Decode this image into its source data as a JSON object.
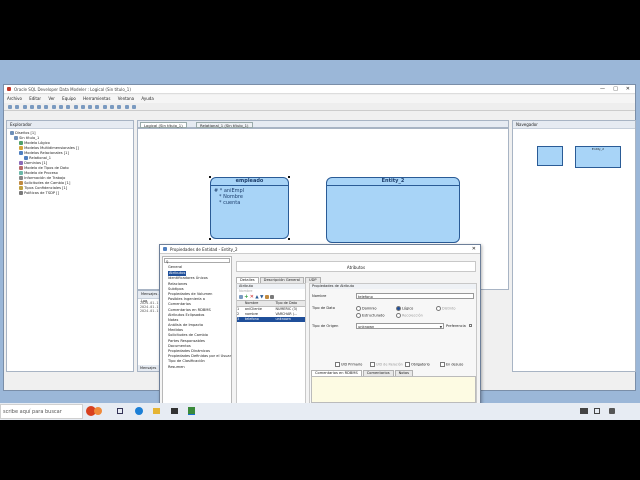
{
  "app": {
    "title": "Oracle SQL Developer Data Modeler : Logical (Sin título_1)",
    "menus": [
      "Archivo",
      "Editar",
      "Ver",
      "Equipo",
      "Herramientas",
      "Ventana",
      "Ayuda"
    ]
  },
  "explorer": {
    "title": "Explorador",
    "items": [
      "Diseños [1]",
      "Sin título_1",
      "Modelo Lógico",
      "Modelos Multidimensionales []",
      "Modelos Relacionales [1]",
      "Relational_1",
      "Dominios [1]",
      "Modelo de Tipos de Dato",
      "Modelo de Proceso",
      "Información de Trabajo",
      "Solicitudes de Cambio [1]",
      "Tipos Confidenciales [1]",
      "Políticas de TSDP []"
    ]
  },
  "editor_tabs": [
    "Logical (Sin título_1)",
    "Relational_1 (Sin título_1)"
  ],
  "entities": {
    "empleado": {
      "name": "empleado",
      "attrs": [
        "# * aniEmpl",
        "* Nombre",
        "* cuenta"
      ]
    },
    "entity2": {
      "name": "Entity_2"
    }
  },
  "navigator": {
    "title": "Navegador",
    "mini_label": "Entity_2"
  },
  "messages": {
    "tab": "Mensajes - Log",
    "lines": [
      "2024-01-1",
      "2024-01-1",
      "2024-01-1"
    ],
    "bottom_tab": "Mensajes"
  },
  "dialog": {
    "title": "Propiedades de Entidad - Entity_2",
    "search_placeholder": "",
    "categories": [
      "General",
      "Atributos",
      "Identificadores Únicos",
      "Relaciones",
      "Subtipos",
      "Propiedades de Volumen",
      "Posibles Ingeniería a",
      "Comentarios",
      "Comentarios en RDBMS",
      "Atributos Eclipsados",
      "Notas",
      "Análisis de Impacto",
      "Medidas",
      "Solicitudes de Cambio",
      "Partes Responsables",
      "Documentos",
      "Propiedades Dinámicas",
      "Propiedades Definidas por el Usuar",
      "Tipo de Clasificación",
      "Resumen"
    ],
    "section_header": "Atributos",
    "subtabs": [
      "Detalles",
      "Descripción General",
      "UDP"
    ],
    "attr_panel_title": "Atributo",
    "attr_filter_placeholder": "Nombre",
    "attr_columns": [
      "",
      "Nombre",
      "Tipo de Dato"
    ],
    "attr_rows": [
      [
        "1",
        "aniCliente",
        "NUMERIC (3)"
      ],
      [
        "2",
        "nombre",
        "VARCHAR (..."
      ],
      [
        "3",
        "telefono",
        "unknown"
      ]
    ],
    "props": {
      "title": "Propiedades de Atributo",
      "name_label": "Nombre",
      "name_value": "telefono",
      "datatype_label": "Tipo de Dato",
      "datatype_options": [
        "Dominio",
        "Lógico",
        "Distinto",
        "Estructurado",
        "Recolección"
      ],
      "source_label": "Tipo de Origen",
      "source_value": "unknown",
      "preference_label": "Preferencia",
      "checks": [
        "UID Primario",
        "UID de Relación",
        "Obligatorio",
        "En desuso"
      ],
      "bottom_tabs": [
        "Comentarios en RDBMS",
        "Comentarios",
        "Notas"
      ]
    }
  },
  "taskbar": {
    "search_text": "scribe aquí para buscar"
  },
  "colors": {
    "entity_fill": "#a8d4f7",
    "entity_border": "#2a5b96",
    "selection": "#1f4f9a"
  }
}
